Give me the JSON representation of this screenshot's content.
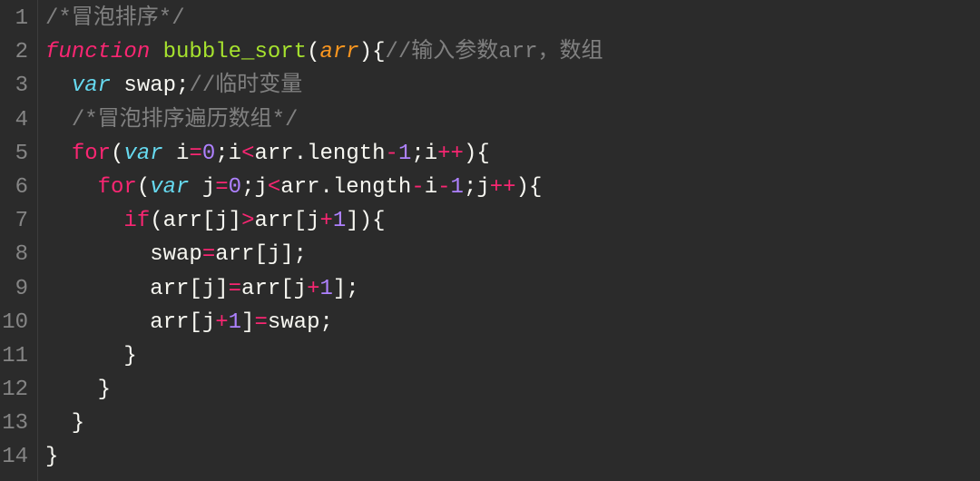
{
  "lines": [
    {
      "n": "1",
      "tokens": [
        {
          "cls": "tok-comment",
          "t": "/*冒泡排序*/"
        }
      ]
    },
    {
      "n": "2",
      "tokens": [
        {
          "cls": "tok-keyword",
          "t": "function"
        },
        {
          "cls": "tok-ident",
          "t": " "
        },
        {
          "cls": "tok-funcname",
          "t": "bubble_sort"
        },
        {
          "cls": "tok-punct",
          "t": "("
        },
        {
          "cls": "tok-param",
          "t": "arr"
        },
        {
          "cls": "tok-punct",
          "t": "){"
        },
        {
          "cls": "tok-comment",
          "t": "//输入参数arr，数组"
        }
      ]
    },
    {
      "n": "3",
      "tokens": [
        {
          "cls": "tok-ident",
          "t": "  "
        },
        {
          "cls": "tok-var",
          "t": "var"
        },
        {
          "cls": "tok-ident",
          "t": " swap"
        },
        {
          "cls": "tok-punct",
          "t": ";"
        },
        {
          "cls": "tok-comment",
          "t": "//临时变量"
        }
      ]
    },
    {
      "n": "4",
      "tokens": [
        {
          "cls": "tok-ident",
          "t": "  "
        },
        {
          "cls": "tok-comment",
          "t": "/*冒泡排序遍历数组*/"
        }
      ]
    },
    {
      "n": "5",
      "tokens": [
        {
          "cls": "tok-ident",
          "t": "  "
        },
        {
          "cls": "tok-keyword-ctrl",
          "t": "for"
        },
        {
          "cls": "tok-punct",
          "t": "("
        },
        {
          "cls": "tok-var",
          "t": "var"
        },
        {
          "cls": "tok-ident",
          "t": " i"
        },
        {
          "cls": "tok-op",
          "t": "="
        },
        {
          "cls": "tok-num",
          "t": "0"
        },
        {
          "cls": "tok-punct",
          "t": ";i"
        },
        {
          "cls": "tok-op",
          "t": "<"
        },
        {
          "cls": "tok-ident",
          "t": "arr.length"
        },
        {
          "cls": "tok-op",
          "t": "-"
        },
        {
          "cls": "tok-num",
          "t": "1"
        },
        {
          "cls": "tok-punct",
          "t": ";i"
        },
        {
          "cls": "tok-op",
          "t": "++"
        },
        {
          "cls": "tok-punct",
          "t": "){"
        }
      ]
    },
    {
      "n": "6",
      "tokens": [
        {
          "cls": "tok-ident",
          "t": "    "
        },
        {
          "cls": "tok-keyword-ctrl",
          "t": "for"
        },
        {
          "cls": "tok-punct",
          "t": "("
        },
        {
          "cls": "tok-var",
          "t": "var"
        },
        {
          "cls": "tok-ident",
          "t": " j"
        },
        {
          "cls": "tok-op",
          "t": "="
        },
        {
          "cls": "tok-num",
          "t": "0"
        },
        {
          "cls": "tok-punct",
          "t": ";j"
        },
        {
          "cls": "tok-op",
          "t": "<"
        },
        {
          "cls": "tok-ident",
          "t": "arr.length"
        },
        {
          "cls": "tok-op",
          "t": "-"
        },
        {
          "cls": "tok-ident",
          "t": "i"
        },
        {
          "cls": "tok-op",
          "t": "-"
        },
        {
          "cls": "tok-num",
          "t": "1"
        },
        {
          "cls": "tok-punct",
          "t": ";j"
        },
        {
          "cls": "tok-op",
          "t": "++"
        },
        {
          "cls": "tok-punct",
          "t": "){"
        }
      ]
    },
    {
      "n": "7",
      "tokens": [
        {
          "cls": "tok-ident",
          "t": "      "
        },
        {
          "cls": "tok-keyword-ctrl",
          "t": "if"
        },
        {
          "cls": "tok-punct",
          "t": "(arr[j]"
        },
        {
          "cls": "tok-op",
          "t": ">"
        },
        {
          "cls": "tok-punct",
          "t": "arr[j"
        },
        {
          "cls": "tok-op",
          "t": "+"
        },
        {
          "cls": "tok-num",
          "t": "1"
        },
        {
          "cls": "tok-punct",
          "t": "]){"
        }
      ]
    },
    {
      "n": "8",
      "tokens": [
        {
          "cls": "tok-ident",
          "t": "        swap"
        },
        {
          "cls": "tok-op",
          "t": "="
        },
        {
          "cls": "tok-punct",
          "t": "arr[j];"
        }
      ]
    },
    {
      "n": "9",
      "tokens": [
        {
          "cls": "tok-ident",
          "t": "        arr[j]"
        },
        {
          "cls": "tok-op",
          "t": "="
        },
        {
          "cls": "tok-punct",
          "t": "arr[j"
        },
        {
          "cls": "tok-op",
          "t": "+"
        },
        {
          "cls": "tok-num",
          "t": "1"
        },
        {
          "cls": "tok-punct",
          "t": "];"
        }
      ]
    },
    {
      "n": "10",
      "tokens": [
        {
          "cls": "tok-ident",
          "t": "        arr[j"
        },
        {
          "cls": "tok-op",
          "t": "+"
        },
        {
          "cls": "tok-num",
          "t": "1"
        },
        {
          "cls": "tok-punct",
          "t": "]"
        },
        {
          "cls": "tok-op",
          "t": "="
        },
        {
          "cls": "tok-punct",
          "t": "swap;"
        }
      ]
    },
    {
      "n": "11",
      "tokens": [
        {
          "cls": "tok-punct",
          "t": "      }"
        }
      ]
    },
    {
      "n": "12",
      "tokens": [
        {
          "cls": "tok-punct",
          "t": "    }"
        }
      ]
    },
    {
      "n": "13",
      "tokens": [
        {
          "cls": "tok-punct",
          "t": "  }"
        }
      ]
    },
    {
      "n": "14",
      "tokens": [
        {
          "cls": "tok-punct",
          "t": "}"
        }
      ]
    }
  ]
}
